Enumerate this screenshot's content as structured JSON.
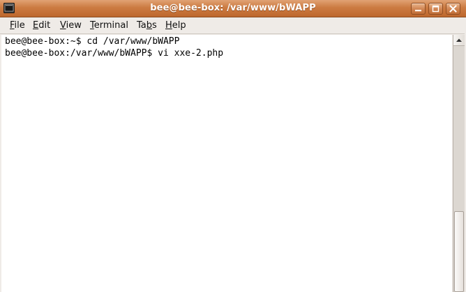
{
  "window": {
    "title": "bee@bee-box: /var/www/bWAPP",
    "app_icon": "terminal-icon",
    "controls": [
      "minimize-icon",
      "maximize-icon",
      "close-icon"
    ]
  },
  "menubar": {
    "items": [
      {
        "mnemonic": "F",
        "rest": "ile"
      },
      {
        "mnemonic": "E",
        "rest": "dit"
      },
      {
        "mnemonic": "V",
        "rest": "iew"
      },
      {
        "mnemonic": "T",
        "rest": "erminal"
      },
      {
        "pre": "Ta",
        "mnemonic": "b",
        "rest": "s"
      },
      {
        "mnemonic": "H",
        "rest": "elp"
      }
    ]
  },
  "terminal": {
    "lines": [
      "bee@bee-box:~$ cd /var/www/bWAPP",
      "bee@bee-box:/var/www/bWAPP$ vi xxe-2.php"
    ]
  },
  "colors": {
    "titlebar_accent": "#cc7b42",
    "terminal_background": "#ffffff",
    "terminal_text": "#000000",
    "chrome_background": "#efebe7"
  }
}
